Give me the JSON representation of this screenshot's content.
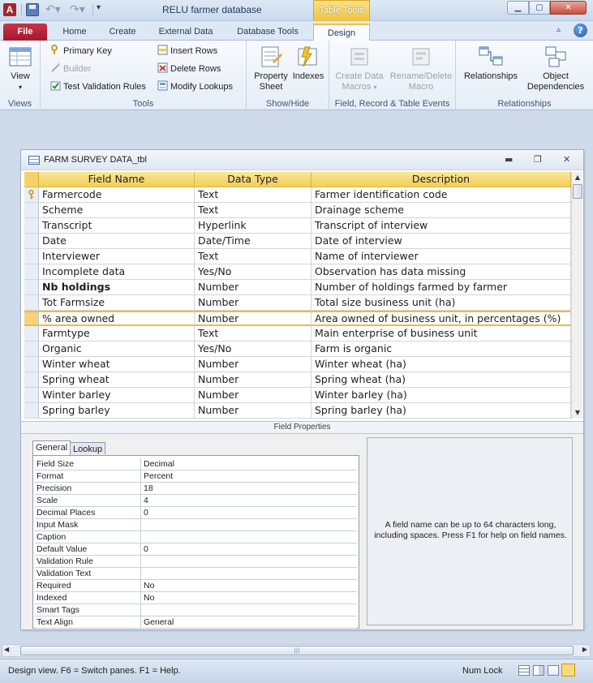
{
  "window": {
    "title": "RELU farmer database",
    "context_tab_group": "Table Tools",
    "app_icon_letter": "A"
  },
  "ribbon": {
    "tabs": [
      "File",
      "Home",
      "Create",
      "External Data",
      "Database Tools",
      "Design"
    ],
    "active_tab": "Design",
    "groups": {
      "views": {
        "label": "Views",
        "view_button": "View"
      },
      "tools": {
        "label": "Tools",
        "primary_key": "Primary Key",
        "builder": "Builder",
        "test_validation_rules": "Test Validation Rules",
        "insert_rows": "Insert Rows",
        "delete_rows": "Delete Rows",
        "modify_lookups": "Modify Lookups"
      },
      "show_hide": {
        "label": "Show/Hide",
        "property_sheet_line1": "Property",
        "property_sheet_line2": "Sheet",
        "indexes": "Indexes"
      },
      "field_record_table_events": {
        "label": "Field, Record & Table Events",
        "create_data_macros_line1": "Create Data",
        "create_data_macros_line2": "Macros",
        "rename_delete_macro_line1": "Rename/Delete",
        "rename_delete_macro_line2": "Macro"
      },
      "relationships": {
        "label": "Relationships",
        "relationships_button": "Relationships",
        "object_dependencies_line1": "Object",
        "object_dependencies_line2": "Dependencies"
      }
    }
  },
  "table_window": {
    "title": "FARM SURVEY DATA_tbl",
    "columns": [
      "Field Name",
      "Data Type",
      "Description"
    ],
    "rows": [
      {
        "name": "Farmercode",
        "type": "Text",
        "description": "Farmer identification code",
        "primary_key": true
      },
      {
        "name": "Scheme",
        "type": "Text",
        "description": "Drainage scheme"
      },
      {
        "name": "Transcript",
        "type": "Hyperlink",
        "description": "Transcript of interview"
      },
      {
        "name": "Date",
        "type": "Date/Time",
        "description": "Date of interview"
      },
      {
        "name": "Interviewer",
        "type": "Text",
        "description": "Name of interviewer"
      },
      {
        "name": "Incomplete data",
        "type": "Yes/No",
        "description": "Observation has data missing"
      },
      {
        "name": "Nb holdings",
        "type": "Number",
        "description": "Number of holdings farmed by farmer",
        "bold": true
      },
      {
        "name": "Tot Farmsize",
        "type": "Number",
        "description": "Total size business unit (ha)"
      },
      {
        "name": "% area owned",
        "type": "Number",
        "description": "Area owned of business unit, in percentages (%)",
        "current": true
      },
      {
        "name": "Farmtype",
        "type": "Text",
        "description": "Main enterprise of business unit"
      },
      {
        "name": "Organic",
        "type": "Yes/No",
        "description": "Farm is organic"
      },
      {
        "name": "Winter wheat",
        "type": "Number",
        "description": "Winter wheat (ha)"
      },
      {
        "name": "Spring wheat",
        "type": "Number",
        "description": "Spring wheat (ha)"
      },
      {
        "name": "Winter barley",
        "type": "Number",
        "description": "Winter barley (ha)"
      },
      {
        "name": "Spring barley",
        "type": "Number",
        "description": "Spring barley (ha)"
      }
    ],
    "field_properties_label": "Field Properties",
    "property_tabs": [
      "General",
      "Lookup"
    ],
    "active_property_tab": "General",
    "properties": [
      {
        "name": "Field Size",
        "value": "Decimal"
      },
      {
        "name": "Format",
        "value": "Percent"
      },
      {
        "name": "Precision",
        "value": "18"
      },
      {
        "name": "Scale",
        "value": "4"
      },
      {
        "name": "Decimal Places",
        "value": "0"
      },
      {
        "name": "Input Mask",
        "value": ""
      },
      {
        "name": "Caption",
        "value": ""
      },
      {
        "name": "Default Value",
        "value": "0"
      },
      {
        "name": "Validation Rule",
        "value": ""
      },
      {
        "name": "Validation Text",
        "value": ""
      },
      {
        "name": "Required",
        "value": "No"
      },
      {
        "name": "Indexed",
        "value": "No"
      },
      {
        "name": "Smart Tags",
        "value": ""
      },
      {
        "name": "Text Align",
        "value": "General"
      }
    ],
    "help_text": "A field name can be up to 64 characters long, including spaces. Press F1 for help on field names."
  },
  "status_bar": {
    "text": "Design view.  F6 = Switch panes.  F1 = Help.",
    "num_lock": "Num Lock"
  },
  "colors": {
    "file_tab": "#a3192f",
    "context_tab": "#eec441",
    "header_row": "#f3cf55",
    "workspace": "#cfdbea"
  }
}
